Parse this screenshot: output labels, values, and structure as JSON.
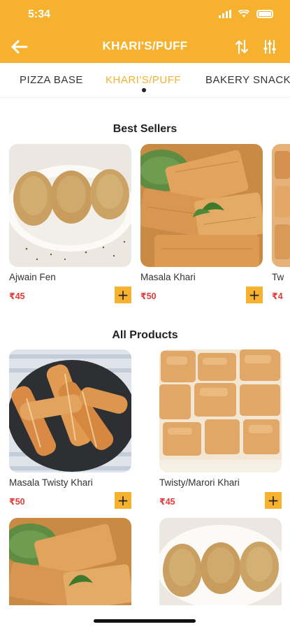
{
  "status_bar": {
    "time": "5:34"
  },
  "header": {
    "title": "KHARI'S/PUFF"
  },
  "tabs": [
    {
      "label": "PIZZA BASE"
    },
    {
      "label": "KHARI'S/PUFF"
    },
    {
      "label": "BAKERY SNACKS"
    }
  ],
  "best_sellers": {
    "title": "Best Sellers",
    "items": [
      {
        "name": "Ajwain Fen",
        "price": "₹45"
      },
      {
        "name": "Masala Khari",
        "price": "₹50"
      },
      {
        "name": "Tw",
        "price": "₹4"
      }
    ]
  },
  "all_products": {
    "title": "All Products",
    "items": [
      {
        "name": "Masala Twisty Khari",
        "price": "₹50"
      },
      {
        "name": "Twisty/Marori Khari",
        "price": "₹45"
      }
    ]
  },
  "colors": {
    "brand": "#F6B12E",
    "price": "#E23B3B"
  },
  "icons": [
    "signal-icon",
    "wifi-icon",
    "battery-icon",
    "back-arrow-icon",
    "sort-icon",
    "filter-icon",
    "plus-icon"
  ]
}
